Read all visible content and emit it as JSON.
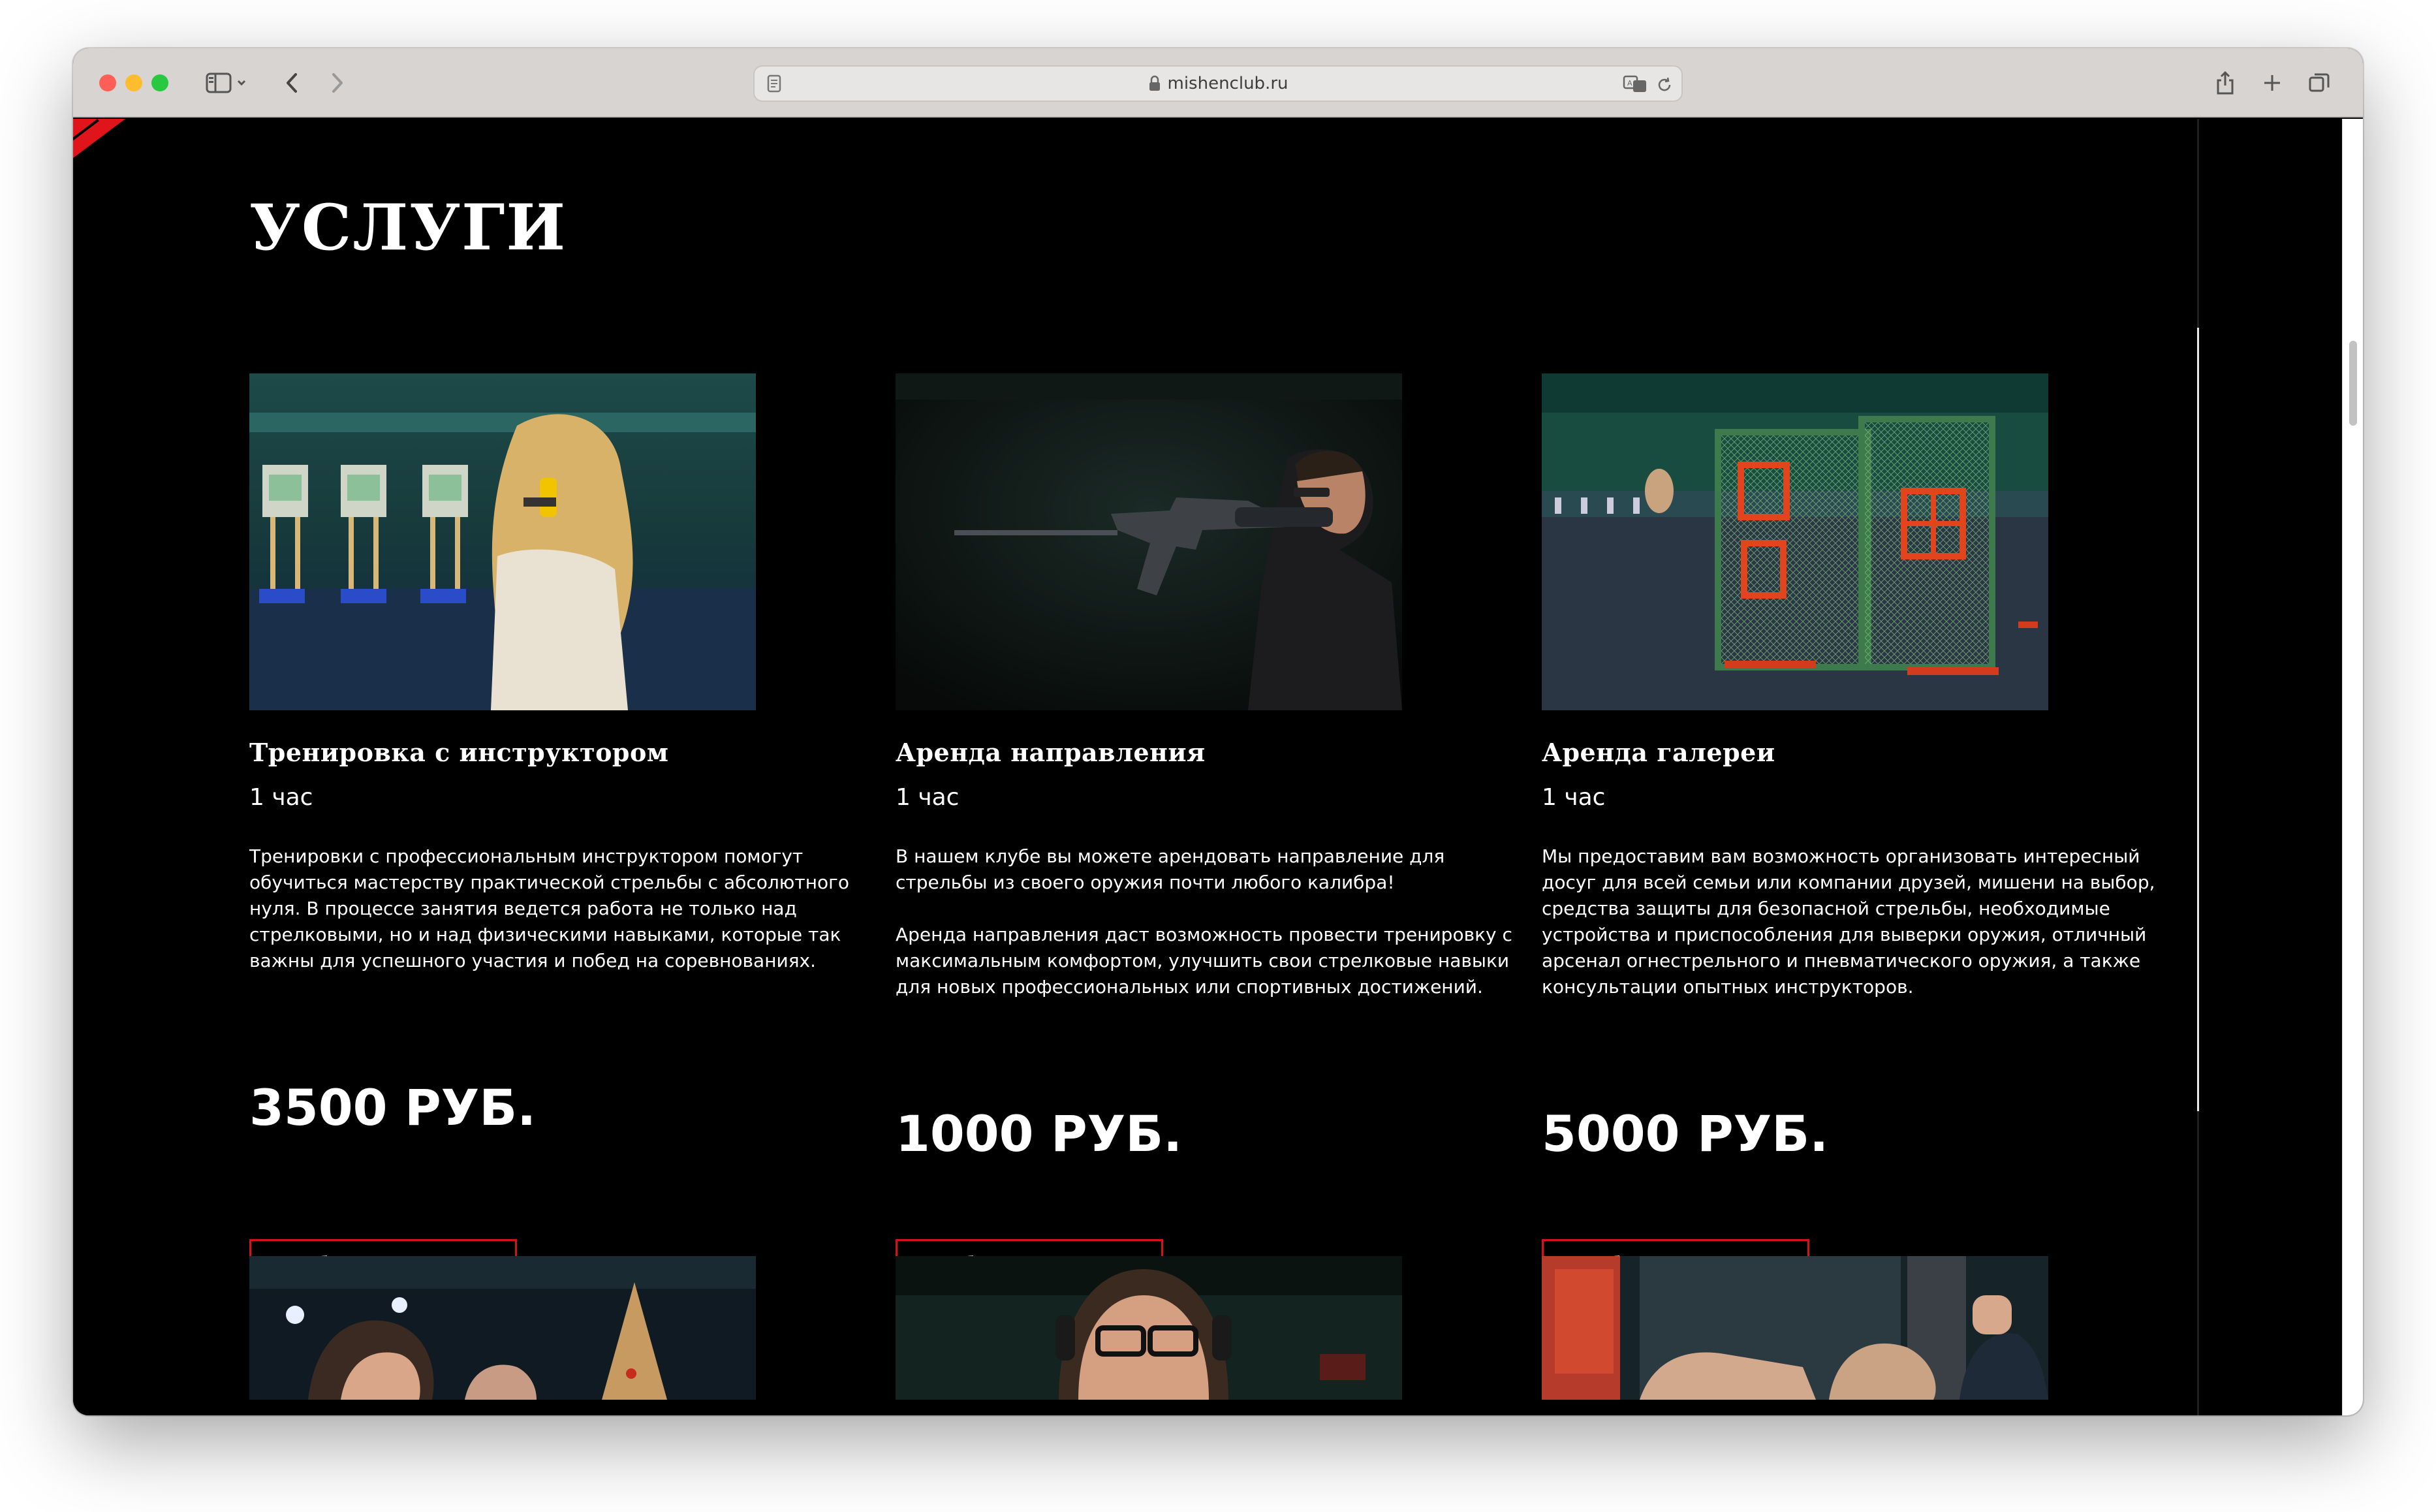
{
  "browser": {
    "url": "mishenclub.ru"
  },
  "page": {
    "section_title": "УСЛУГИ"
  },
  "services": [
    {
      "name": "Тренировка с инструктором",
      "duration": "1 час",
      "description": [
        "Тренировки с профессиональным инструктором помогут обучиться мастерству практической стрельбы с абсолютного нуля. В процессе занятия ведется работа не только над стрелковыми, но и над физическими навыками, которые так важны для успешного участия и побед на соревнованиях."
      ],
      "price": "3500 РУБ.",
      "button": "Забронировать"
    },
    {
      "name": "Аренда направления",
      "duration": "1 час",
      "description": [
        "В нашем клубе вы можете арендовать направление для стрельбы из своего оружия почти любого калибра!",
        "Аренда направления даст возможность провести тренировку с максимальным комфортом, улучшить свои стрелковые навыки для новых профессиональных или спортивных достижений."
      ],
      "price": "1000 РУБ.",
      "button": "Забронировать"
    },
    {
      "name": "Аренда галереи",
      "duration": "1 час",
      "description": [
        "Мы предоставим вам возможность организовать интересный досуг для всей семьи или компании друзей, мишени на выбор, средства защиты для безопасной стрельбы, необходимые устройства и приспособления для выверки оружия, отличный арсенал огнестрельного и пневматического оружия, а также консультации опытных инструкторов."
      ],
      "price": "5000 РУБ.",
      "button": "Забронировать"
    }
  ]
}
